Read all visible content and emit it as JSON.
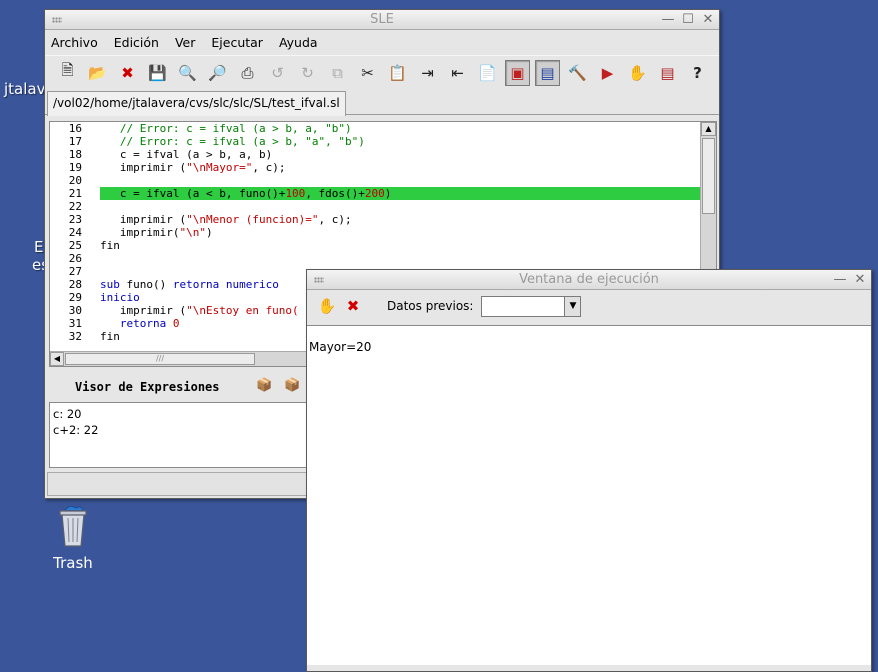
{
  "desktop": {
    "partial_label_1": "jtalav",
    "partial_label_2": "E",
    "partial_label_3": "es",
    "trash_label": "Trash"
  },
  "sle": {
    "title": "SLE",
    "menu": [
      "Archivo",
      "Edición",
      "Ver",
      "Ejecutar",
      "Ayuda"
    ],
    "toolbar_icons": [
      "new-file-icon",
      "open-icon",
      "close-red-icon",
      "save-icon",
      "zoom-in-icon",
      "zoom-out-icon",
      "print-icon",
      "undo-icon",
      "redo-icon",
      "copy-icon",
      "cut-icon",
      "paste-icon",
      "indent-icon",
      "unindent-icon",
      "find-icon",
      "window-icon",
      "console-icon",
      "build-icon",
      "run-icon",
      "stop-icon",
      "watch-icon",
      "help-icon"
    ],
    "tab_path": "/vol02/home/jtalavera/cvs/slc/slc/SL/test_ifval.sl",
    "line_numbers": [
      "16",
      "17",
      "18",
      "19",
      "20",
      "21",
      "22",
      "23",
      "24",
      "25",
      "26",
      "27",
      "28",
      "29",
      "30",
      "31",
      "32"
    ],
    "code_lines": [
      "   // Error: c = ifval (a > b, a, \"b\")",
      "   // Error: c = ifval (a > b, \"a\", \"b\")",
      "   c = ifval (a > b, a, b)",
      "   imprimir (\"\\nMayor=\", c);",
      "",
      "   c = ifval (a < b, funo()+100, fdos()+200)",
      "",
      "   imprimir (\"\\nMenor (funcion)=\", c);",
      "   imprimir(\"\\n\")",
      "fin",
      "",
      "",
      "sub funo() retorna numerico",
      "inicio",
      "   imprimir (\"\\nEstoy en funo(",
      "   retorna 0",
      "fin"
    ],
    "highlight_line": "21",
    "visor": {
      "title": "Visor de Expresiones",
      "items": [
        "c: 20",
        "c+2: 22"
      ]
    }
  },
  "exec": {
    "title": "Ventana de ejecución",
    "datos_label": "Datos previos:",
    "output": "Mayor=20"
  },
  "colors": {
    "desktop": "#3a5599",
    "highlight": "#2ecc40",
    "comment": "#008000",
    "string": "#c00000",
    "keyword": "#0000c0"
  }
}
